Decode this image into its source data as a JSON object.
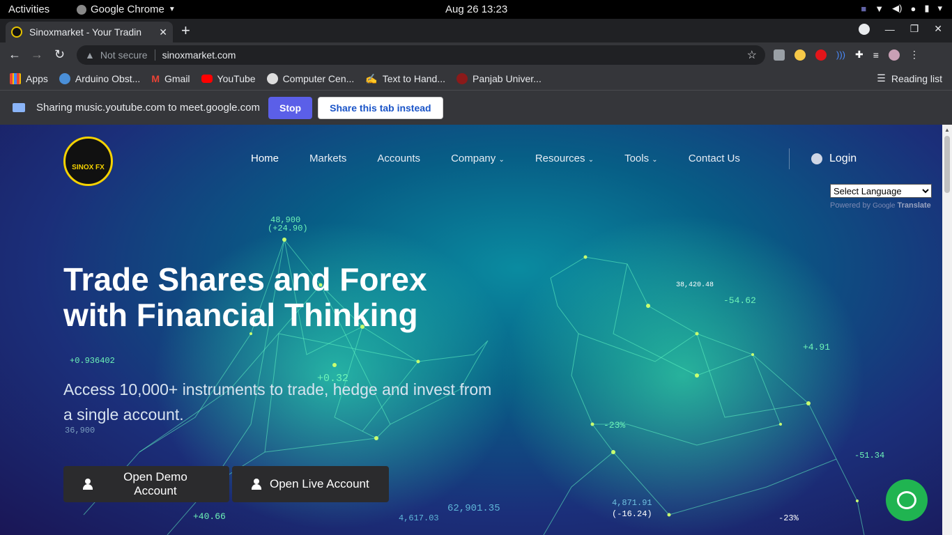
{
  "system": {
    "activities": "Activities",
    "app_name": "Google Chrome",
    "clock": "Aug 26  13:23"
  },
  "browser": {
    "tab_title": "Sinoxmarket - Your Tradin",
    "security": "Not secure",
    "url": "sinoxmarket.com",
    "bookmarks": [
      "Apps",
      "Arduino Obst...",
      "Gmail",
      "YouTube",
      "Computer Cen...",
      "Text to Hand...",
      "Panjab Univer..."
    ],
    "reading_list": "Reading list"
  },
  "sharebar": {
    "message": "Sharing music.youtube.com to meet.google.com",
    "stop": "Stop",
    "share_tab": "Share this tab instead"
  },
  "site": {
    "logo_text": "SINOX FX",
    "nav": {
      "home": "Home",
      "markets": "Markets",
      "accounts": "Accounts",
      "company": "Company",
      "resources": "Resources",
      "tools": "Tools",
      "contact": "Contact Us"
    },
    "login": "Login",
    "language": "Select Language",
    "powered_by": "Powered by",
    "google": "Google",
    "translate": "Translate",
    "hero_line1": "Trade Shares and Forex",
    "hero_line2": "with Financial Thinking",
    "subtitle": "Access 10,000+ instruments to trade, hedge and invest from a single account.",
    "demo_btn": "Open Demo Account",
    "live_btn": "Open Live Account",
    "tickers": [
      "48,900",
      "(+24.90)",
      "+0.936402",
      "+0.32",
      "36,900",
      "+40.66",
      "4,617.03",
      "62,901.35",
      "-54.62",
      "+4.91",
      "-23%",
      "-51.34",
      "4,871.91",
      "(-16.24)",
      "-23%",
      "38,420.48"
    ]
  },
  "colors": {
    "accent": "#5b5fe8",
    "chat_green": "#20b451",
    "logo_gold": "#f5d200"
  }
}
